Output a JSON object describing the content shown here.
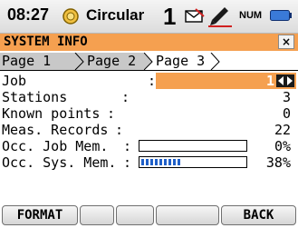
{
  "status_bar": {
    "time": "08:27",
    "mode": "Circular",
    "face": "1",
    "num_label": "NUM",
    "icons": [
      "target-icon",
      "envelope-icon",
      "pen-icon",
      "battery-icon"
    ]
  },
  "window": {
    "title": "SYSTEM INFO",
    "close_label": "×",
    "accent_color": "#f5a050"
  },
  "tabs": [
    {
      "label": "Page 1",
      "active": false
    },
    {
      "label": "Page 2",
      "active": false
    },
    {
      "label": "Page 3",
      "active": true
    }
  ],
  "rows": [
    {
      "label": "Job",
      "value": "1"
    },
    {
      "label": "Stations",
      "value": "3"
    },
    {
      "label": "Known points",
      "value": "0"
    },
    {
      "label": "Meas. Records",
      "value": "22"
    },
    {
      "label": "Occ. Job Mem.",
      "value": "0%",
      "fill_fraction": 0.0
    },
    {
      "label": "Occ. Sys. Mem.",
      "value": "38%",
      "fill_fraction": 0.38
    }
  ],
  "softkeys": [
    "FORMAT",
    "",
    "",
    "",
    "BACK"
  ]
}
